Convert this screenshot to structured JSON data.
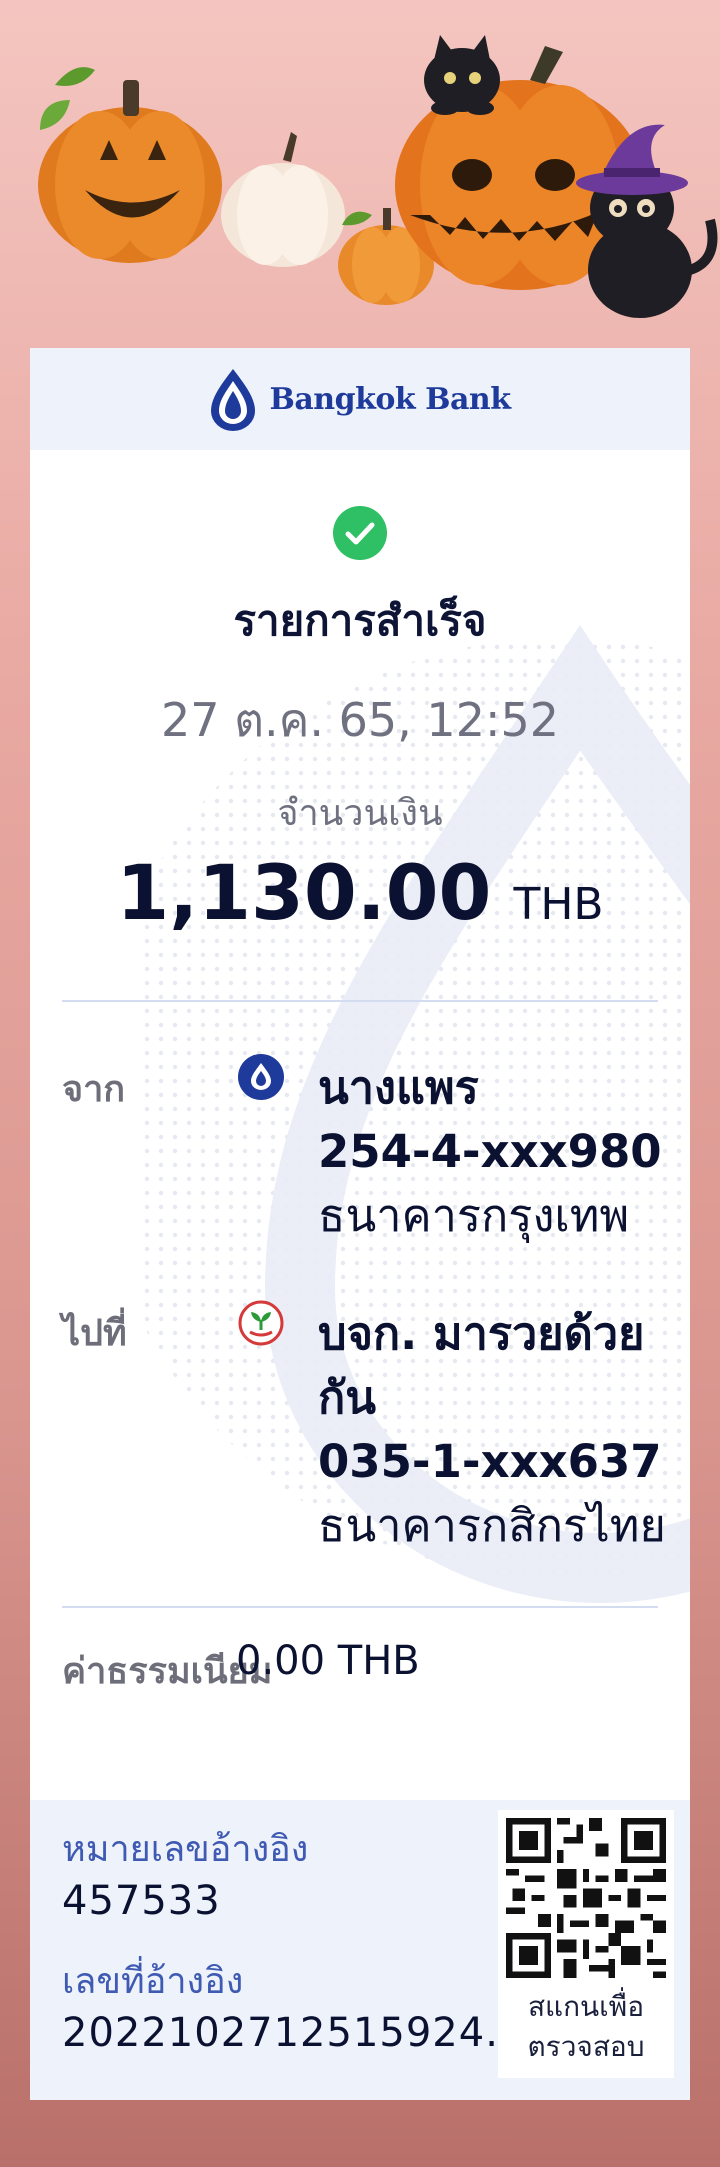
{
  "brand": {
    "name": "Bangkok Bank",
    "logo_icon": "bangkok-bank-lotus-icon",
    "color": "#1e3a9b"
  },
  "banner": {
    "theme": "halloween",
    "icons": [
      "pumpkin-icon",
      "black-cat-icon",
      "witch-hat-icon"
    ]
  },
  "status": {
    "icon": "check-circle-icon",
    "color": "#2fbf64",
    "title": "รายการสำเร็จ"
  },
  "datetime": "27 ต.ค. 65, 12:52",
  "amount": {
    "label": "จำนวนเงิน",
    "value": "1,130.00",
    "currency": "THB"
  },
  "from": {
    "label": "จาก",
    "bank_icon": "bangkok-bank-icon",
    "name": "นางแพร",
    "account": "254-4-xxx980",
    "bank": "ธนาคารกรุงเทพ"
  },
  "to": {
    "label": "ไปที่",
    "bank_icon": "kasikorn-bank-icon",
    "name_line1": "บจก. มารวยด้วย",
    "name_line2": "กัน",
    "account": "035-1-xxx637",
    "bank": "ธนาคารกสิกรไทย"
  },
  "fee": {
    "label": "ค่าธรรมเนียม",
    "value": "0.00 THB"
  },
  "reference": {
    "ref_label": "หมายเลขอ้างอิง",
    "ref_value": "457533",
    "txn_label": "เลขที่อ้างอิง",
    "txn_value": "2022102712515924."
  },
  "qr": {
    "icon": "qr-code-icon",
    "caption_line1": "สแกนเพื่อ",
    "caption_line2": "ตรวจสอบ"
  }
}
